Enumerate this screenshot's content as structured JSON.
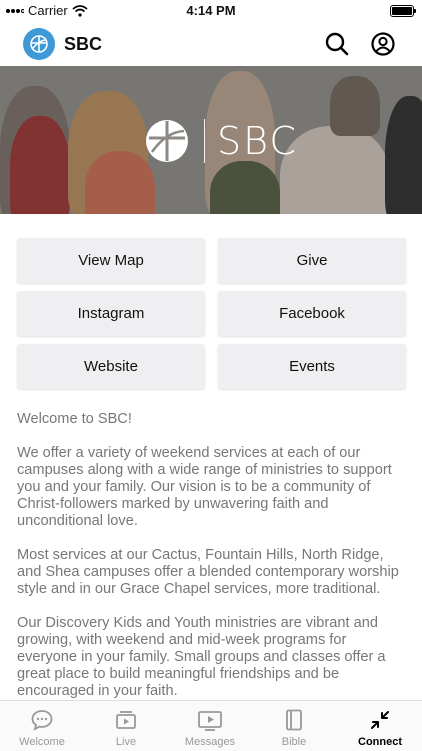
{
  "status_bar": {
    "carrier": "Carrier",
    "time": "4:14 PM"
  },
  "header": {
    "title": "SBC"
  },
  "hero": {
    "logo_text": "SBC"
  },
  "buttons": [
    {
      "label": "View Map"
    },
    {
      "label": "Give"
    },
    {
      "label": "Instagram"
    },
    {
      "label": "Facebook"
    },
    {
      "label": "Website"
    },
    {
      "label": "Events"
    }
  ],
  "content": {
    "paragraphs": [
      "Welcome to SBC!",
      "We offer a variety of weekend services at each of our campuses along with a wide range of ministries to support you and your family. Our vision is to be a community of Christ-followers marked by unwavering faith and unconditional love.",
      "Most services at our Cactus, Fountain Hills, North Ridge, and Shea campuses offer a blended contemporary worship style and in our Grace Chapel services, more traditional.",
      "Our Discovery Kids and Youth ministries are vibrant and growing, with weekend and mid-week programs for everyone in your family. Small groups and classes offer a great place to build meaningful friendships and be encouraged in your faith."
    ]
  },
  "tabs": [
    {
      "label": "Welcome",
      "icon": "chat-bubble-icon",
      "active": false
    },
    {
      "label": "Live",
      "icon": "live-video-icon",
      "active": false
    },
    {
      "label": "Messages",
      "icon": "play-screen-icon",
      "active": false
    },
    {
      "label": "Bible",
      "icon": "book-icon",
      "active": false
    },
    {
      "label": "Connect",
      "icon": "collapse-arrows-icon",
      "active": true
    }
  ],
  "colors": {
    "brand": "#3d9ad6",
    "tile_bg": "#efeff1",
    "text_muted": "#777777"
  }
}
